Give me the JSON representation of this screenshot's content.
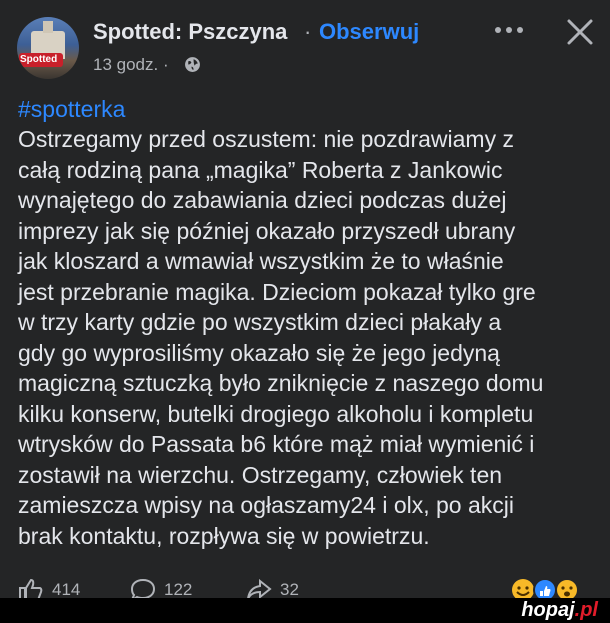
{
  "post_header": {
    "page_name": "Spotted: Pszczyna",
    "separator": "·",
    "follow_label": "Obserwuj",
    "timestamp": "13 godz. ·",
    "avatar_text": "Spotted"
  },
  "post": {
    "hashtag": "#spotterka",
    "lines": [
      "Ostrzegamy przed oszustem: nie pozdrawiamy z",
      "całą rodziną pana „magika” Roberta z Jankowic",
      "wynajętego do zabawiania dzieci podczas dużej",
      "imprezy jak się później okazało przyszedł ubrany",
      "jak kloszard a wmawiał wszystkim że to właśnie",
      "jest przebranie magika. Dzieciom pokazał tylko gre",
      "w trzy karty gdzie po wszystkim dzieci płakały a",
      "gdy go wyprosiliśmy okazało się że  jego jedyną",
      "magiczną sztuczką było zniknięcie z naszego domu",
      "kilku konserw, butelki drogiego alkoholu i kompletu",
      "wtrysków do Passata b6 które mąż miał wymienić i",
      "zostawił na wierzchu. Ostrzegamy, człowiek ten",
      "zamieszcza wpisy na ogłaszamy24 i olx, po akcji",
      "brak kontaktu, rozpływa się w powietrzu."
    ]
  },
  "actions": {
    "likes": "414",
    "comments": "122",
    "shares": "32"
  },
  "watermark": {
    "brand": "hopaj",
    "tld": ".pl"
  },
  "icons": [
    "globe-icon",
    "more-icon",
    "close-icon",
    "like-icon",
    "comment-icon",
    "share-icon",
    "reactions-icon"
  ]
}
